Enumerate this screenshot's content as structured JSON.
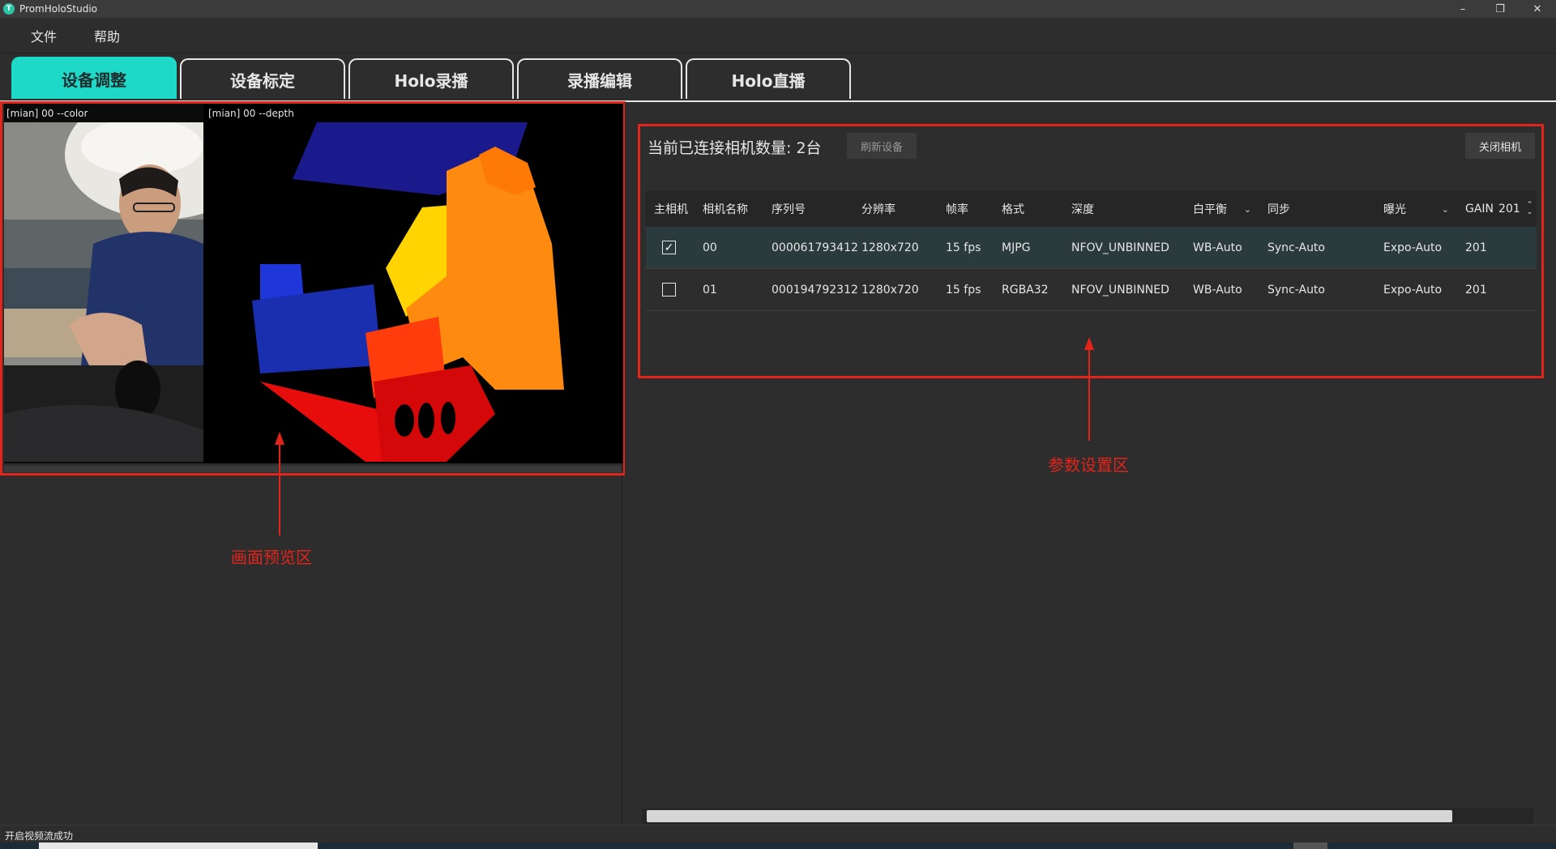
{
  "window": {
    "title": "PromHoloStudio",
    "logo_letter": "T",
    "minimize": "–",
    "restore": "❐",
    "close": "✕"
  },
  "menu": {
    "file": "文件",
    "help": "帮助"
  },
  "tabs": [
    "设备调整",
    "设备标定",
    "Holo录播",
    "录播编辑",
    "Holo直播"
  ],
  "preview": {
    "color_label": "[mian] 00 --color",
    "depth_label": "[mian] 00 --depth",
    "annotation": "画面预览区"
  },
  "params": {
    "connected_text": "当前已连接相机数量: 2台",
    "refresh_button": "刷新设备",
    "close_camera_button": "关闭相机",
    "annotation": "参数设置区",
    "columns": [
      "主相机",
      "相机名称",
      "序列号",
      "分辨率",
      "帧率",
      "格式",
      "深度",
      "白平衡",
      "同步",
      "曝光",
      "GAIN"
    ],
    "gain_header_value": "201",
    "rows": [
      {
        "main": true,
        "name": "00",
        "serial": "000061793412",
        "resolution": "1280x720",
        "fps": "15 fps",
        "format": "MJPG",
        "depth": "NFOV_UNBINNED",
        "wb": "WB-Auto",
        "sync": "Sync-Auto",
        "expo": "Expo-Auto",
        "gain": "201"
      },
      {
        "main": false,
        "name": "01",
        "serial": "000194792312",
        "resolution": "1280x720",
        "fps": "15 fps",
        "format": "RGBA32",
        "depth": "NFOV_UNBINNED",
        "wb": "WB-Auto",
        "sync": "Sync-Auto",
        "expo": "Expo-Auto",
        "gain": "201"
      }
    ]
  },
  "status": {
    "text": "开启视频流成功"
  },
  "colors": {
    "accent": "#1ed8c8",
    "annotation": "#e3241b",
    "background": "#2d2d2d"
  }
}
